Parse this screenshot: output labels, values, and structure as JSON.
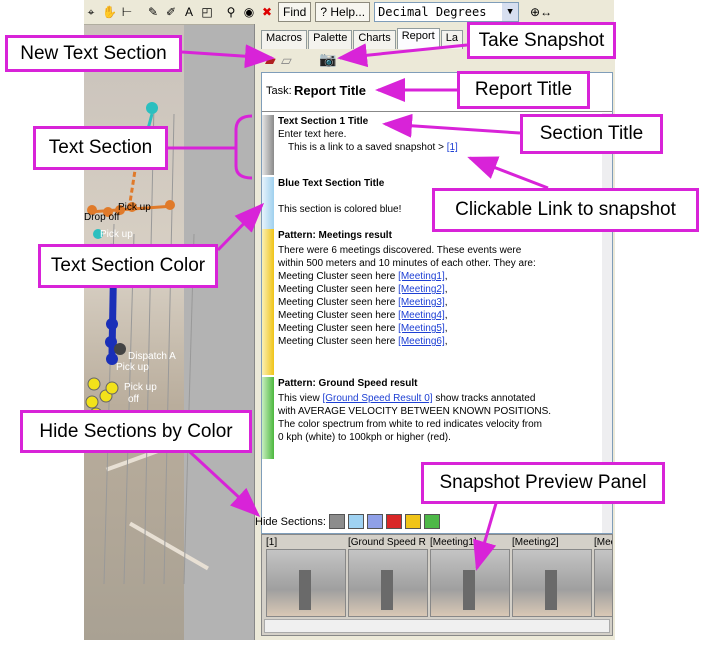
{
  "toolbar": {
    "find_label": "Find",
    "help_label": "Help...",
    "coord_format": "Decimal Degrees"
  },
  "tabs": [
    "Macros",
    "Palette",
    "Charts",
    "Report",
    "La"
  ],
  "task": {
    "label": "Task:",
    "title": "Report Title"
  },
  "sections": [
    {
      "title": "Text Section 1 Title",
      "lines": [
        "Enter text here.",
        "This is a link to a saved snapshot >"
      ],
      "link": "[1]",
      "color": "#a8a8a8"
    },
    {
      "title": "Blue Text Section Title",
      "lines": [
        "This section is colored blue!"
      ],
      "color": "#a8d4f2"
    },
    {
      "title": "Pattern: Meetings result",
      "intro": [
        "There were 6 meetings discovered. These events were",
        "within 500 meters and 10 minutes of each other.  They are:"
      ],
      "item_prefix": "Meeting Cluster seen here",
      "links": [
        "[Meeting1]",
        "[Meeting2]",
        "[Meeting3]",
        "[Meeting4]",
        "[Meeting5]",
        "[Meeting6]"
      ],
      "color": "#f0c418"
    },
    {
      "title": "Pattern: Ground Speed result",
      "line1_pre": "This view",
      "line1_link": "[Ground Speed Result 0]",
      "line1_post": "show tracks annotated",
      "lines": [
        "with AVERAGE VELOCITY BETWEEN KNOWN POSITIONS.",
        "The color spectrum from white to red indicates velocity from",
        "0 kph (white) to 100kph or higher (red)."
      ],
      "color": "#5cb83e"
    }
  ],
  "hide_sections": {
    "label": "Hide Sections:",
    "colors": [
      "#8c8c8c",
      "#9fd2f2",
      "#8fa0e8",
      "#d92727",
      "#f0c418",
      "#4db848"
    ]
  },
  "snapshots": [
    "[1]",
    "[Ground Speed R",
    "[Meeting1]",
    "[Meeting2]",
    "[Mee"
  ],
  "map_labels": [
    "Pick up",
    "Drop off",
    "Pick up",
    "Dispatch A",
    "Pick up",
    "Pick up",
    "off"
  ],
  "callouts": {
    "new_text_section": "New Text Section",
    "take_snapshot": "Take Snapshot",
    "report_title": "Report Title",
    "text_section": "Text Section",
    "section_title": "Section Title",
    "clickable_link": "Clickable Link to snapshot",
    "text_section_color": "Text Section Color",
    "hide_sections_by_color": "Hide Sections by Color",
    "snapshot_preview_panel": "Snapshot Preview Panel"
  }
}
